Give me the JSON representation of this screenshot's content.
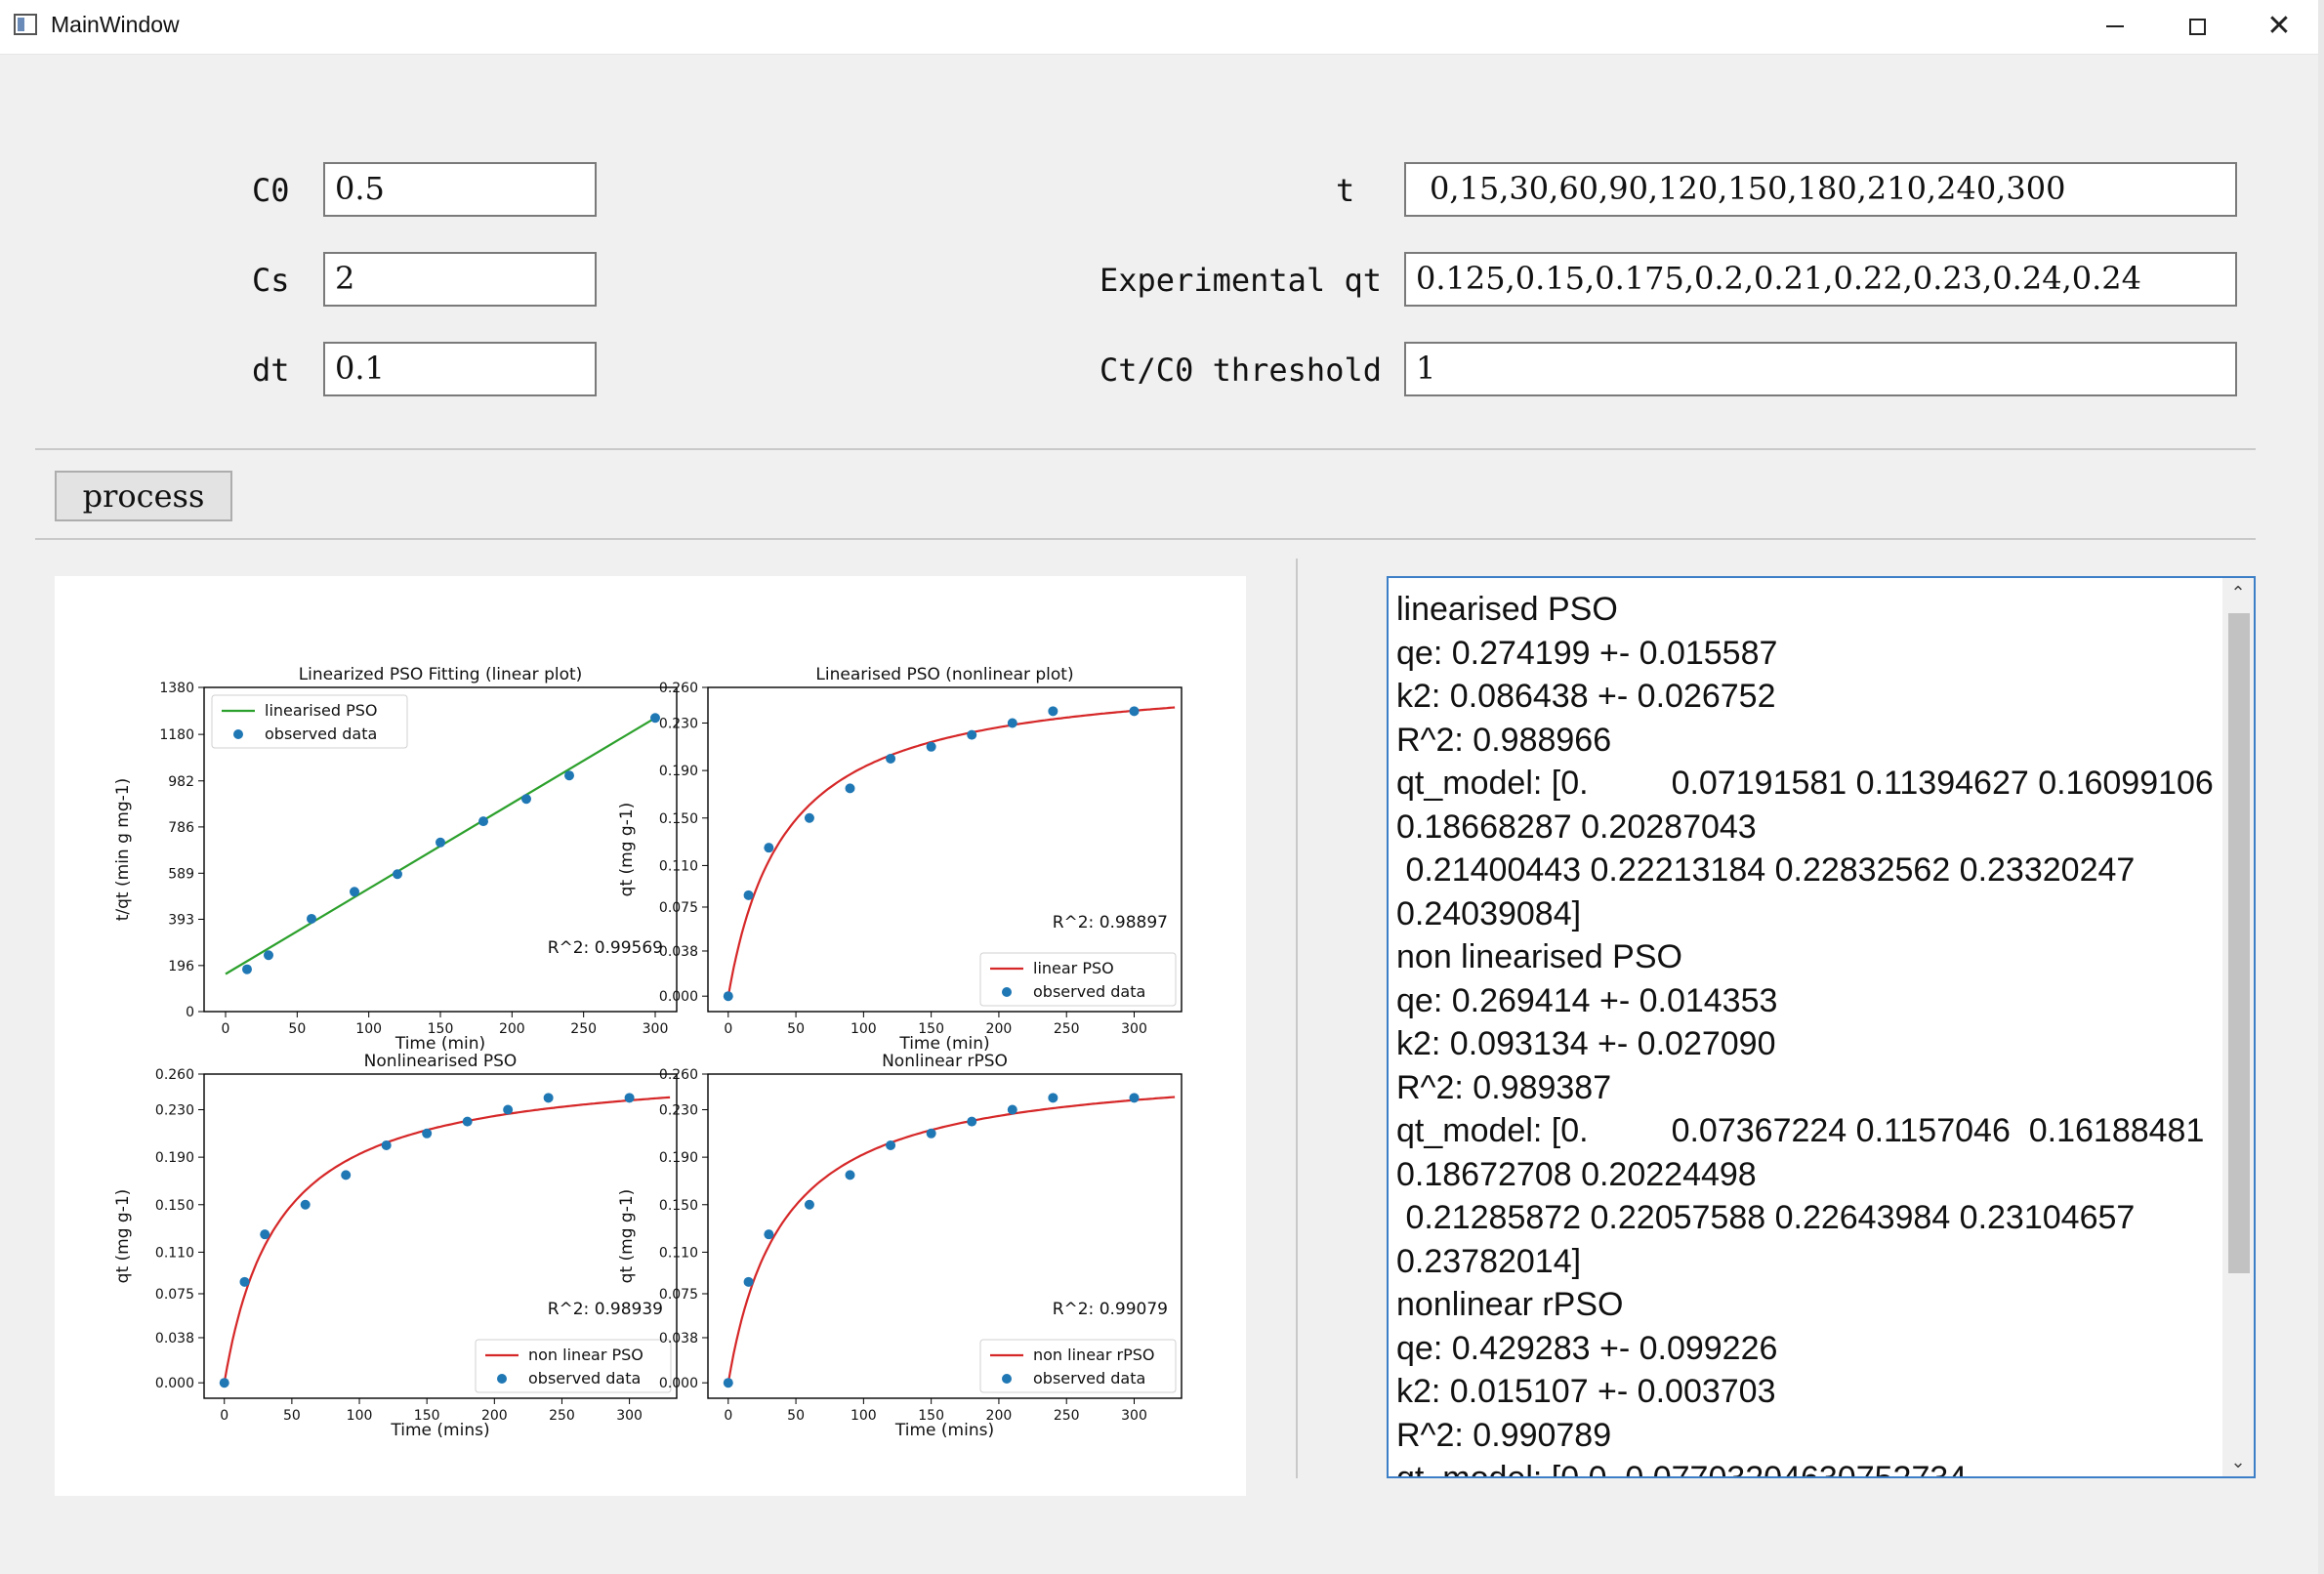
{
  "window": {
    "title": "MainWindow"
  },
  "inputs": {
    "c0": {
      "label": "C0",
      "value": "0.5"
    },
    "cs": {
      "label": "Cs",
      "value": "2"
    },
    "dt": {
      "label": "dt",
      "value": "0.1"
    },
    "t": {
      "label": "t",
      "value": "0,15,30,60,90,120,150,180,210,240,300"
    },
    "qt": {
      "label": "Experimental qt",
      "value": "0.125,0.15,0.175,0.2,0.21,0.22,0.23,0.24,0.24"
    },
    "threshold": {
      "label": "Ct/C0 threshold",
      "value": "1"
    }
  },
  "process_label": "process",
  "output_text": "linearised PSO\nqe: 0.274199 +- 0.015587\nk2: 0.086438 +- 0.026752\nR^2: 0.988966\nqt_model: [0.         0.07191581 0.11394627 0.16099106\n0.18668287 0.20287043\n 0.21400443 0.22213184 0.22832562 0.23320247\n0.24039084]\nnon linearised PSO\nqe: 0.269414 +- 0.014353\nk2: 0.093134 +- 0.027090\nR^2: 0.989387\nqt_model: [0.         0.07367224 0.1157046  0.16188481\n0.18672708 0.20224498\n 0.21285872 0.22057588 0.22643984 0.23104657\n0.23782014]\nnonlinear rPSO\nqe: 0.429283 +- 0.099226\nk2: 0.015107 +- 0.003703\nR^2: 0.990789\nqt_model: [0.0  0.07703204630752734",
  "colors": {
    "observed": "#1f77b4",
    "linear_fit": "#2ca02c",
    "model_fit": "#d62728"
  },
  "chart_data": [
    {
      "type": "scatter",
      "title": "Linearized PSO Fitting (linear plot)",
      "xlabel": "Time (min)",
      "ylabel": "t/qt (min g mg-1)",
      "xlim": [
        -15,
        315
      ],
      "ylim": [
        0,
        1380
      ],
      "xticks": [
        "0",
        "50",
        "100",
        "150",
        "200",
        "250",
        "300"
      ],
      "yticks": [
        "0",
        "196",
        "393",
        "589",
        "786",
        "982",
        "1180",
        "1380"
      ],
      "ytick_values": [
        0,
        196,
        393,
        589,
        786,
        982,
        1180,
        1380
      ],
      "annotation": "R^2: 0.99569",
      "legend": {
        "placement": "top-left",
        "entries": [
          "linearised PSO",
          "observed data"
        ]
      },
      "x": [
        15,
        30,
        60,
        90,
        120,
        150,
        180,
        210,
        240,
        300
      ],
      "y": [
        180,
        240,
        395,
        510,
        585,
        720,
        810,
        905,
        1005,
        1250
      ],
      "fit": {
        "type": "line",
        "color": "#2ca02c",
        "x": [
          0,
          300
        ],
        "y": [
          160,
          1250
        ]
      }
    },
    {
      "type": "scatter",
      "title": "Linearised PSO (nonlinear plot)",
      "xlabel": "Time (min)",
      "ylabel": "qt (mg g-1)",
      "xlim": [
        -15,
        335
      ],
      "ylim": [
        -0.013,
        0.26
      ],
      "xticks": [
        "0",
        "50",
        "100",
        "150",
        "200",
        "250",
        "300"
      ],
      "yticks": [
        "0.000",
        "0.038",
        "0.075",
        "0.110",
        "0.150",
        "0.190",
        "0.230",
        "0.260"
      ],
      "ytick_values": [
        0,
        0.038,
        0.075,
        0.11,
        0.15,
        0.19,
        0.23,
        0.26
      ],
      "annotation": "R^2: 0.98897",
      "legend": {
        "placement": "bottom-right",
        "entries": [
          "linear PSO",
          "observed data"
        ]
      },
      "x": [
        0,
        15,
        30,
        60,
        90,
        120,
        150,
        180,
        210,
        240,
        300
      ],
      "y": [
        0,
        0.085,
        0.125,
        0.15,
        0.175,
        0.2,
        0.21,
        0.22,
        0.23,
        0.24,
        0.24
      ],
      "fit": {
        "type": "pso",
        "color": "#d62728",
        "qe": 0.274199,
        "k2": 0.086438,
        "x_max": 330
      }
    },
    {
      "type": "scatter",
      "title": "Nonlinearised PSO",
      "xlabel": "Time (mins)",
      "ylabel": "qt (mg g-1)",
      "xlim": [
        -15,
        335
      ],
      "ylim": [
        -0.013,
        0.26
      ],
      "xticks": [
        "0",
        "50",
        "100",
        "150",
        "200",
        "250",
        "300"
      ],
      "yticks": [
        "0.000",
        "0.038",
        "0.075",
        "0.110",
        "0.150",
        "0.190",
        "0.230",
        "0.260"
      ],
      "ytick_values": [
        0,
        0.038,
        0.075,
        0.11,
        0.15,
        0.19,
        0.23,
        0.26
      ],
      "annotation": "R^2: 0.98939",
      "legend": {
        "placement": "bottom-right",
        "entries": [
          "non linear PSO",
          "observed data"
        ]
      },
      "x": [
        0,
        15,
        30,
        60,
        90,
        120,
        150,
        180,
        210,
        240,
        300
      ],
      "y": [
        0,
        0.085,
        0.125,
        0.15,
        0.175,
        0.2,
        0.21,
        0.22,
        0.23,
        0.24,
        0.24
      ],
      "fit": {
        "type": "pso",
        "color": "#d62728",
        "qe": 0.269414,
        "k2": 0.093134,
        "x_max": 330
      }
    },
    {
      "type": "scatter",
      "title": "Nonlinear rPSO",
      "xlabel": "Time (mins)",
      "ylabel": "qt (mg g-1)",
      "xlim": [
        -15,
        335
      ],
      "ylim": [
        -0.013,
        0.26
      ],
      "xticks": [
        "0",
        "50",
        "100",
        "150",
        "200",
        "250",
        "300"
      ],
      "yticks": [
        "0.000",
        "0.038",
        "0.075",
        "0.110",
        "0.150",
        "0.190",
        "0.230",
        "0.260"
      ],
      "ytick_values": [
        0,
        0.038,
        0.075,
        0.11,
        0.15,
        0.19,
        0.23,
        0.26
      ],
      "annotation": "R^2: 0.99079",
      "legend": {
        "placement": "bottom-right",
        "entries": [
          "non linear rPSO",
          "observed data"
        ]
      },
      "x": [
        0,
        15,
        30,
        60,
        90,
        120,
        150,
        180,
        210,
        240,
        300
      ],
      "y": [
        0,
        0.085,
        0.125,
        0.15,
        0.175,
        0.2,
        0.21,
        0.22,
        0.23,
        0.24,
        0.24
      ],
      "fit": {
        "type": "pso",
        "color": "#d62728",
        "qe": 0.27,
        "k2": 0.092,
        "x_max": 330
      }
    }
  ]
}
